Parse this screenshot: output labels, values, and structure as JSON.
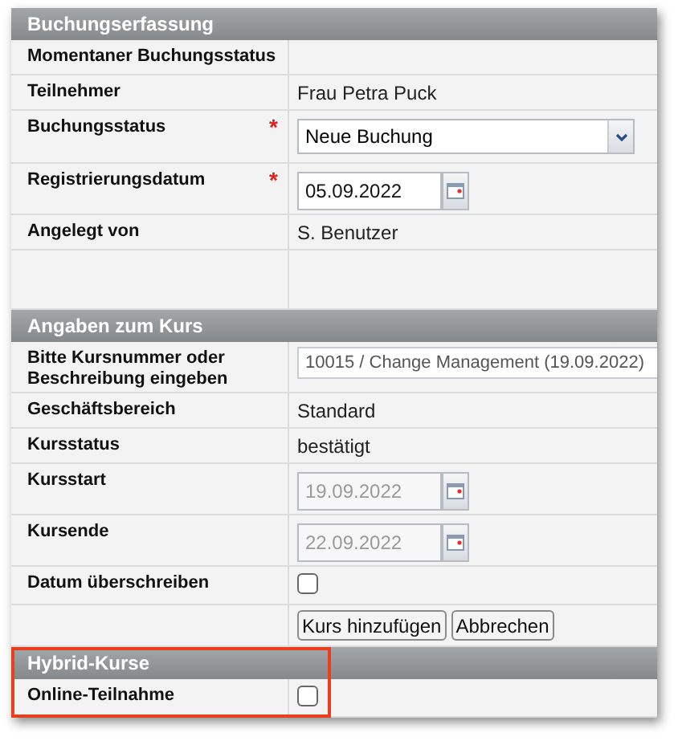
{
  "sections": [
    {
      "title": "Buchungserfassung",
      "rows": [
        {
          "kind": "text",
          "label": "Momentaner Buchungsstatus",
          "value": null
        },
        {
          "kind": "text",
          "label": "Teilnehmer",
          "value": "Frau Petra Puck"
        },
        {
          "kind": "select",
          "label": "Buchungsstatus",
          "marker": "*",
          "value": "Neue Buchung"
        },
        {
          "kind": "date",
          "label": "Registrierungsdatum",
          "marker": "*",
          "value": "05.09.2022",
          "disabled": false
        },
        {
          "kind": "text",
          "label": "Angelegt von",
          "value": "S. Benutzer"
        },
        {
          "kind": "empty"
        }
      ]
    },
    {
      "title": "Angaben zum Kurs",
      "rows": [
        {
          "kind": "input",
          "label": "Bitte Kursnummer oder Beschreibung eingeben",
          "value": "10015 / Change Management (19.09.2022)"
        },
        {
          "kind": "text",
          "label": "Geschäftsbereich",
          "value": "Standard"
        },
        {
          "kind": "text",
          "label": "Kursstatus",
          "value": "bestätigt"
        },
        {
          "kind": "date",
          "label": "Kursstart",
          "value": "19.09.2022",
          "disabled": true
        },
        {
          "kind": "date",
          "label": "Kursende",
          "value": "22.09.2022",
          "disabled": true
        },
        {
          "kind": "checkbox",
          "label": "Datum überschreiben",
          "checked": false
        },
        {
          "kind": "buttons",
          "buttons": [
            "Kurs hinzufügen",
            "Abbrechen"
          ]
        }
      ]
    },
    {
      "title": "Hybrid-Kurse",
      "highlighted": true,
      "rows": [
        {
          "kind": "checkbox",
          "label": "Online-Teilnahme",
          "checked": false
        }
      ]
    }
  ]
}
